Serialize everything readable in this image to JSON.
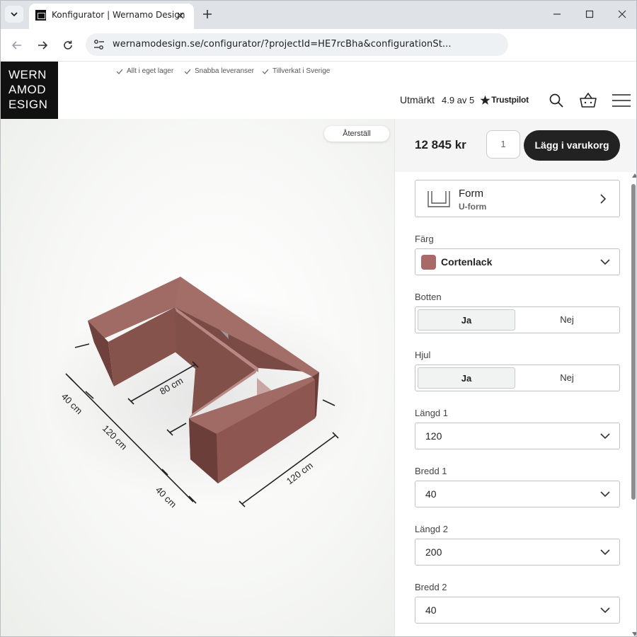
{
  "browser": {
    "tab_title": "Konfigurator | Wernamo Design",
    "url": "wernamodesign.se/configurator/?projectId=HE7rcBha&configurationSt..."
  },
  "site": {
    "logo_lines": [
      "WERN",
      "AMOD",
      "ESIGN"
    ],
    "usps": [
      "Allt i eget lager",
      "Snabba leveranser",
      "Tillverkat i Sverige"
    ],
    "trust_label": "Utmärkt",
    "trust_rating": "4.9 av 5",
    "trustpilot": "Trustpilot"
  },
  "viewer": {
    "reset_label": "Återställ",
    "dimensions": [
      "40 cm",
      "120 cm",
      "40 cm",
      "80 cm",
      "120 cm"
    ]
  },
  "panel": {
    "price": "12 845 kr",
    "quantity": "1",
    "add_to_cart": "Lägg i varukorg",
    "form_title": "Form",
    "form_value": "U-form",
    "color_label": "Färg",
    "color_value": "Cortenlack",
    "color_hex": "#a86a66",
    "bottom_label": "Botten",
    "bottom_yes": "Ja",
    "bottom_no": "Nej",
    "wheels_label": "Hjul",
    "wheels_yes": "Ja",
    "wheels_no": "Nej",
    "length1_label": "Längd 1",
    "length1_value": "120",
    "width1_label": "Bredd 1",
    "width1_value": "40",
    "length2_label": "Längd 2",
    "length2_value": "200",
    "width2_label": "Bredd 2",
    "width2_value": "40"
  }
}
